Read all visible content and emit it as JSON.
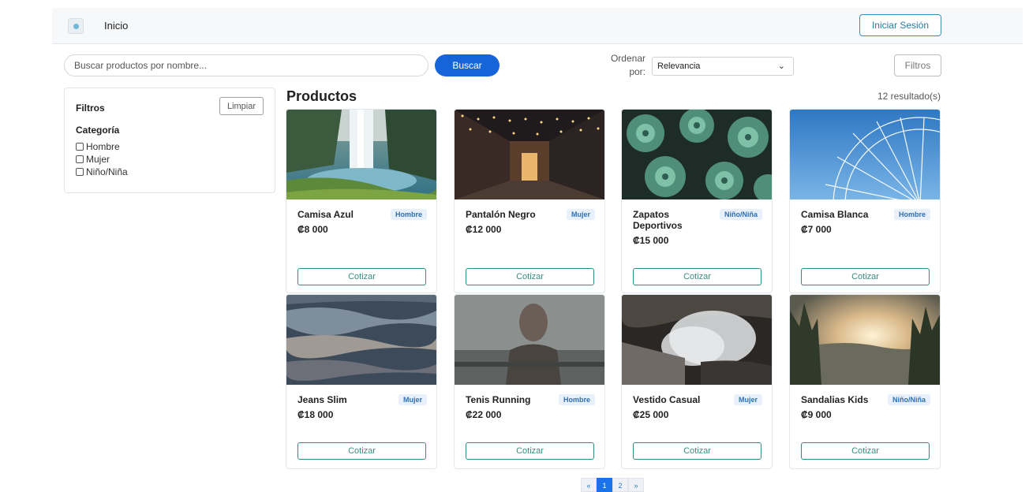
{
  "navbar": {
    "brand": "Inicio",
    "login_label": "Iniciar Sesión"
  },
  "search": {
    "placeholder": "Buscar productos por nombre...",
    "value": "",
    "button_label": "Buscar"
  },
  "sort": {
    "label": "Ordenar por:",
    "selected": "Relevancia"
  },
  "filters_button_label": "Filtros",
  "sidebar": {
    "title": "Filtros",
    "clear_label": "Limpiar",
    "category_title": "Categoría",
    "categories": [
      "Hombre",
      "Mujer",
      "Niño/Niña"
    ]
  },
  "products_title": "Productos",
  "results_text": "12 resultado(s)",
  "products": [
    {
      "name": "Camisa Azul",
      "badge": "Hombre",
      "price": "₡8 000",
      "button": "Cotizar",
      "image": "waterfall-image"
    },
    {
      "name": "Pantalón Negro",
      "badge": "Mujer",
      "price": "₡12 000",
      "button": "Cotizar",
      "image": "street-lights-image"
    },
    {
      "name": "Zapatos Deportivos",
      "badge": "Niño/Niña",
      "price": "₡15 000",
      "button": "Cotizar",
      "image": "succulents-image"
    },
    {
      "name": "Camisa Blanca",
      "badge": "Hombre",
      "price": "₡7 000",
      "button": "Cotizar",
      "image": "ferris-wheel-image"
    },
    {
      "name": "Jeans Slim",
      "badge": "Mujer",
      "price": "₡18 000",
      "button": "Cotizar",
      "image": "water-surface-image"
    },
    {
      "name": "Tenis Running",
      "badge": "Hombre",
      "price": "₡22 000",
      "button": "Cotizar",
      "image": "portrait-window-image"
    },
    {
      "name": "Vestido Casual",
      "badge": "Mujer",
      "price": "₡25 000",
      "button": "Cotizar",
      "image": "misty-waterfall-image"
    },
    {
      "name": "Sandalias Kids",
      "badge": "Niño/Niña",
      "price": "₡9 000",
      "button": "Cotizar",
      "image": "forest-sunset-image"
    }
  ],
  "pagination": {
    "prev": "«",
    "pages": [
      "1",
      "2"
    ],
    "current": "1",
    "next": "»"
  },
  "colors": {
    "primary": "#1565d8",
    "accent_outline": "#2e8f80",
    "badge_bg": "#e7f0fb",
    "badge_text": "#2f6fb4"
  }
}
